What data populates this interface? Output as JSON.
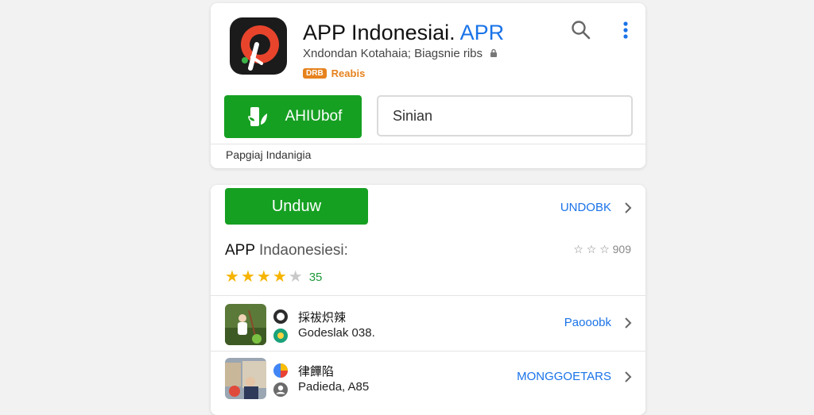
{
  "header": {
    "title_main": "APP Indonesiai.",
    "title_accent": "APR",
    "developer": "Xndondan Kotahaia; Biagsnie ribs",
    "badge": "DRB",
    "badge_text": "Reabis"
  },
  "actions": {
    "install_label": "AHIUbof",
    "secondary_label": "Sinian"
  },
  "top_footer": "Papgiaj Indanigia",
  "download": {
    "label": "Unduw",
    "link": "UNDOBK"
  },
  "app": {
    "name_main": "APP",
    "name_rest": "Indaonesiesi:",
    "rating_text": "☆ ☆ ☆ 909",
    "stars_on": 4,
    "stars_total": 5,
    "rating_count": "35"
  },
  "list": [
    {
      "title": "採祓炽辣",
      "subtitle": "Godeslak 038.",
      "link": "Paooobk"
    },
    {
      "title": "律饆陷",
      "subtitle": "Padieda, A85",
      "link": "MONGGOETARS"
    }
  ],
  "colors": {
    "green": "#16a022",
    "blue": "#1a73e8",
    "orange": "#e6821e",
    "star": "#f6b400"
  },
  "icons": {
    "search": "search-icon",
    "more": "more-vert-icon",
    "chevron": "chevron-right-icon"
  }
}
